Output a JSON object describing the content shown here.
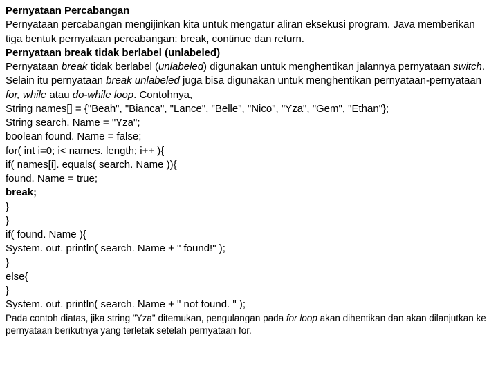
{
  "doc": {
    "title": "Pernyataan Percabangan",
    "p1": "Pernyataan percabangan mengijinkan kita untuk mengatur aliran eksekusi program. Java memberikan tiga bentuk pernyataan percabangan: break, continue dan return.",
    "h2": "Pernyataan break tidak berlabel (unlabeled)",
    "p2a": "Pernyataan ",
    "p2b": "break",
    "p2c": " tidak berlabel (",
    "p2d": "unlabeled",
    "p2e": ") digunakan untuk menghentikan jalannya pernyataan ",
    "p2f": "switch",
    "p2g": ". Selain itu pernyataan ",
    "p2h": "break unlabeled",
    "p2i": " juga bisa digunakan untuk menghentikan pernyataan-pernyataan ",
    "p2j": "for, while",
    "p2k": " atau ",
    "p2l": "do-while loop",
    "p2m": ". Contohnya,",
    "c1": "String names[] = {\"Beah\", \"Bianca\", \"Lance\", \"Belle\", \"Nico\", \"Yza\", \"Gem\", \"Ethan\"};",
    "c2": "String search. Name = \"Yza\";",
    "c3": "boolean found. Name = false;",
    "c4": "for( int i=0; i< names. length; i++ ){",
    "c5": "if( names[i]. equals( search. Name )){",
    "c6": "found. Name = true;",
    "c7": "break;",
    "c8": "}",
    "c9": "}",
    "c10": "if( found. Name ){",
    "c11": "System. out. println( search. Name + \" found!\" );",
    "c12": "}",
    "c13": "else{",
    "c14": "}",
    "c15": "System. out. println( search. Name + \" not found. \" );",
    "foot1": "Pada contoh diatas, jika string \"Yza\" ditemukan, pengulangan pada ",
    "foot2": "for loop",
    "foot3": " akan dihentikan dan akan dilanjutkan ke pernyataan berikutnya yang terletak setelah pernyataan for."
  }
}
